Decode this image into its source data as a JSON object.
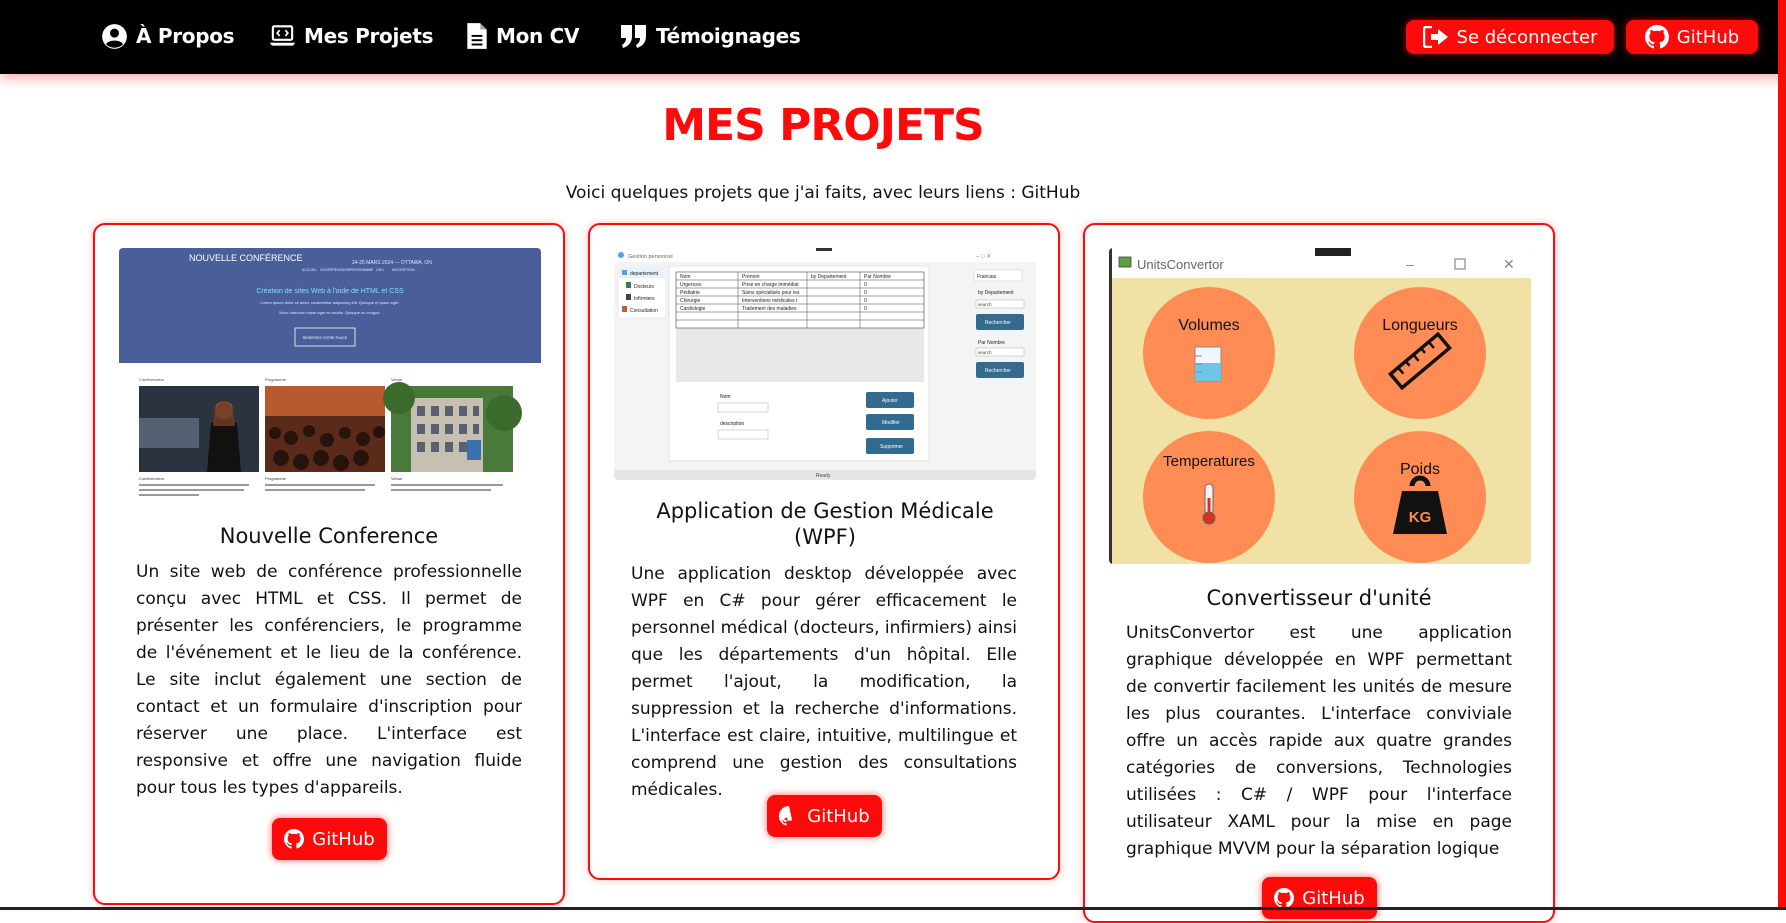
{
  "nav": {
    "about": "À Propos",
    "projects": "Mes Projets",
    "cv": "Mon CV",
    "testimonials": "Témoignages",
    "logout": "Se déconnecter",
    "github": "GitHub"
  },
  "page": {
    "title": "MES PROJETS",
    "subtitle": "Voici quelques projets que j'ai faits, avec leurs liens  : GitHub"
  },
  "projects": [
    {
      "title": "Nouvelle Conference",
      "description": "Un site web de conférence professionnelle conçu avec HTML et CSS. Il permet de présenter les conférenciers, le programme de l'événement et le lieu de la conférence. Le site inclut également une section de contact et un formulaire d'inscription pour réserver une place. L'interface est responsive et offre une navigation fluide pour tous les types d'appareils.",
      "button": "GitHub",
      "screenshot": {
        "brand": "NOUVELLE CONFÉRENCE",
        "date": "24-25 MARS 2024 — OTTAWA, ON",
        "nav": [
          "ACCUEIL",
          "CONFÉRENCIERS",
          "PROGRAMME",
          "LIEU",
          "INSCRIPTION"
        ],
        "headline": "Création de sites Web à l'aide de HTML et CSS",
        "line1": "Lorem ipsum dolor sit amet, consectetur adipiscing elit. Quisque et quam eget.",
        "line2": "Nunc interdum turpis eget ex iaculis. Quisque ac congue.",
        "cta": "RÉSERVEZ VOTRE PLACE",
        "sections": [
          "Conférenciers",
          "Programme",
          "Venue"
        ],
        "cap_titles": [
          "Conférenciers",
          "Programme",
          "Venue"
        ]
      }
    },
    {
      "title": "Application de Gestion Médicale (WPF)",
      "description": "Une application desktop développée avec WPF en C# pour gérer efficacement le personnel médical (docteurs, infirmiers) ainsi que les départements d'un hôpital. Elle permet l'ajout, la modification, la suppression et la recherche d'informations. L'interface est claire, intuitive, multilingue et comprend une gestion des consultations médicales.",
      "button": "GitHub",
      "screenshot": {
        "window_title": "Gestion personnel",
        "menu": [
          "departement",
          "Docteurs",
          "Infirmiers",
          "Consultation"
        ],
        "columns": [
          "Nom",
          "Prénom",
          "by Departement",
          "Par Nombre"
        ],
        "rows": [
          [
            "Urgences",
            "Prise en charge immédiat",
            "",
            "0"
          ],
          [
            "Pédiatrie",
            "Soins spécialisés pour les",
            "",
            "0"
          ],
          [
            "Chirurgie",
            "Interventions médicales r",
            "",
            "0"
          ],
          [
            "Cardiologie",
            "Traitement des maladies",
            "",
            "0"
          ]
        ],
        "lang": "Francais",
        "by_dep": "by Departement",
        "search": "search",
        "search_btn": "Rechercher",
        "par_nombre": "Par Nombre",
        "nom_label": "Nom",
        "desc_label": "description",
        "add": "Ajouter",
        "edit": "Modifier",
        "delete": "Supprimer",
        "status": "Ready"
      }
    },
    {
      "title": "Convertisseur d'unité",
      "description": "UnitsConvertor est une application graphique développée en WPF permettant de convertir facilement les unités de mesure les plus courantes. L'interface conviviale offre un accès rapide aux quatre grandes catégories de conversions, Technologies utilisées : C# / WPF pour l'interface utilisateur XAML pour la mise en page graphique MVVM pour la séparation logique",
      "button": "GitHub",
      "screenshot": {
        "window_title": "UnitsConvertor",
        "tiles": [
          "Volumes",
          "Longueurs",
          "Temperatures",
          "Poids"
        ],
        "kg": "KG"
      }
    }
  ],
  "colors": {
    "accent": "#ff0a0a",
    "navbar": "#000000",
    "tile": "#ff8c55",
    "units_bg": "#f0e2a4",
    "conf_blue": "#4a5f9a"
  }
}
